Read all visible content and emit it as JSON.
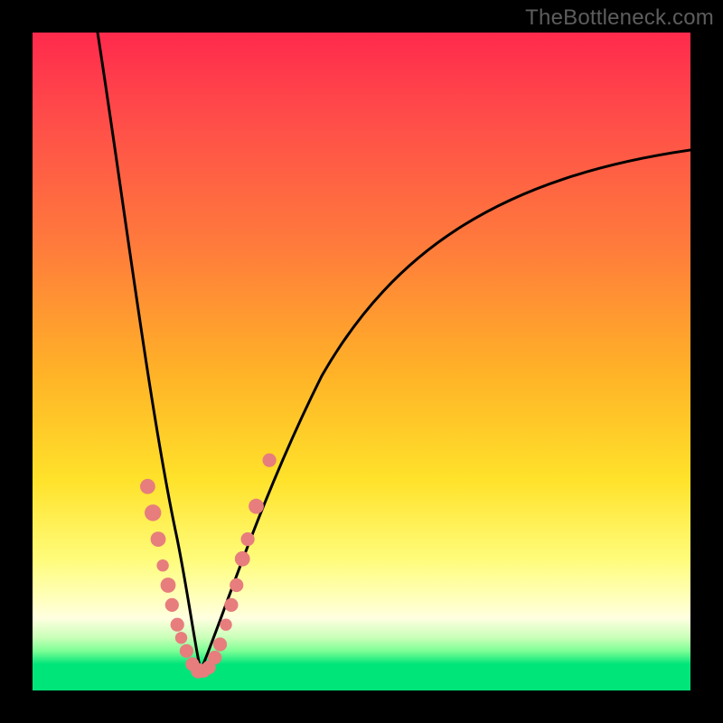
{
  "watermark": "TheBottleneck.com",
  "colors": {
    "background": "#000000",
    "curve": "#000000",
    "markers": "#e77d7d",
    "gradient_stops": [
      "#ff2a4c",
      "#ff7a3c",
      "#ffe22a",
      "#ffffb0",
      "#00e57a"
    ]
  },
  "chart_data": {
    "type": "line",
    "title": "",
    "xlabel": "",
    "ylabel": "",
    "xlim": [
      0,
      100
    ],
    "ylim": [
      0,
      100
    ],
    "curve": {
      "description": "V-shaped bottleneck curve: steep descent from top-left to a minimum near x≈25, then a concave rise toward top-right.",
      "minimum_x": 25,
      "minimum_y": 3,
      "left_top": {
        "x": 10,
        "y": 100
      },
      "right_top": {
        "x": 100,
        "y": 82
      }
    },
    "series": [
      {
        "name": "markers",
        "description": "salmon-colored data points clustered near the curve's bottom",
        "points": [
          {
            "x": 17.5,
            "y": 31,
            "r": 2.0
          },
          {
            "x": 18.3,
            "y": 27,
            "r": 2.2
          },
          {
            "x": 19.1,
            "y": 23,
            "r": 2.0
          },
          {
            "x": 19.8,
            "y": 19,
            "r": 1.6
          },
          {
            "x": 20.6,
            "y": 16,
            "r": 2.0
          },
          {
            "x": 21.2,
            "y": 13,
            "r": 1.8
          },
          {
            "x": 22.0,
            "y": 10,
            "r": 1.8
          },
          {
            "x": 22.6,
            "y": 8,
            "r": 1.6
          },
          {
            "x": 23.4,
            "y": 6,
            "r": 1.8
          },
          {
            "x": 24.3,
            "y": 4,
            "r": 1.8
          },
          {
            "x": 25.2,
            "y": 3,
            "r": 2.0
          },
          {
            "x": 26.0,
            "y": 3,
            "r": 1.8
          },
          {
            "x": 26.8,
            "y": 3.5,
            "r": 1.8
          },
          {
            "x": 27.7,
            "y": 5,
            "r": 1.8
          },
          {
            "x": 28.5,
            "y": 7,
            "r": 1.8
          },
          {
            "x": 29.4,
            "y": 10,
            "r": 1.6
          },
          {
            "x": 30.2,
            "y": 13,
            "r": 1.8
          },
          {
            "x": 31.0,
            "y": 16,
            "r": 1.8
          },
          {
            "x": 31.9,
            "y": 20,
            "r": 2.0
          },
          {
            "x": 32.7,
            "y": 23,
            "r": 1.8
          },
          {
            "x": 34.0,
            "y": 28,
            "r": 2.0
          },
          {
            "x": 36.0,
            "y": 35,
            "r": 1.8
          }
        ]
      }
    ]
  }
}
